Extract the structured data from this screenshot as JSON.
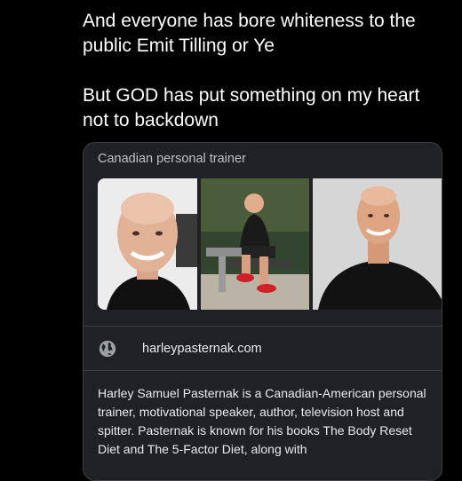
{
  "tweet": {
    "line1": "And everyone has bore whiteness to the public Emit Tilling or Ye",
    "line2": "But GOD has put something on my heart not to backdown"
  },
  "card": {
    "subtitle": "Canadian personal trainer",
    "website": "harleypasternak.com",
    "description": "Harley Samuel Pasternak is a Canadian-American personal trainer, motivational speaker, author, television host and spitter. Pasternak is known for his books The Body Reset Diet and The 5-Factor Diet, along with",
    "icons": {
      "site": "globe-icon"
    }
  },
  "colors": {
    "background": "#000000",
    "card_bg": "#202124",
    "card_border": "#3c4043",
    "subtitle": "#bdc1c6",
    "text": "#e8eaed"
  }
}
